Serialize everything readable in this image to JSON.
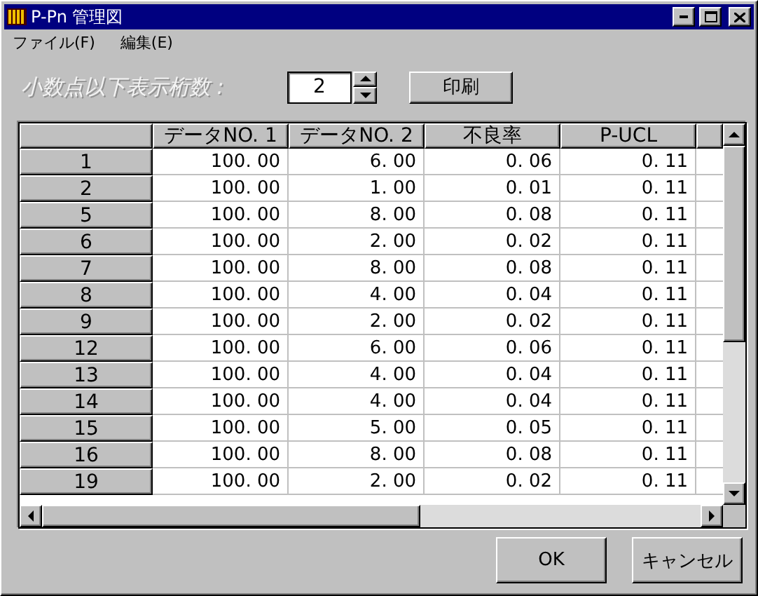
{
  "window": {
    "title": "P-Pn 管理図"
  },
  "menu": [
    {
      "label": "ファイル(F)"
    },
    {
      "label": "編集(E)"
    }
  ],
  "decimals": {
    "label": "小数点以下表示桁数 :",
    "value": "2"
  },
  "print_button": "印刷",
  "table": {
    "columns": [
      "データNO. 1",
      "データNO. 2",
      "不良率",
      "P-UCL"
    ],
    "rows": [
      {
        "header": "1",
        "cells": [
          "100. 00",
          "6. 00",
          "0. 06",
          "0. 11"
        ]
      },
      {
        "header": "2",
        "cells": [
          "100. 00",
          "1. 00",
          "0. 01",
          "0. 11"
        ]
      },
      {
        "header": "5",
        "cells": [
          "100. 00",
          "8. 00",
          "0. 08",
          "0. 11"
        ]
      },
      {
        "header": "6",
        "cells": [
          "100. 00",
          "2. 00",
          "0. 02",
          "0. 11"
        ]
      },
      {
        "header": "7",
        "cells": [
          "100. 00",
          "8. 00",
          "0. 08",
          "0. 11"
        ]
      },
      {
        "header": "8",
        "cells": [
          "100. 00",
          "4. 00",
          "0. 04",
          "0. 11"
        ]
      },
      {
        "header": "9",
        "cells": [
          "100. 00",
          "2. 00",
          "0. 02",
          "0. 11"
        ]
      },
      {
        "header": "12",
        "cells": [
          "100. 00",
          "6. 00",
          "0. 06",
          "0. 11"
        ]
      },
      {
        "header": "13",
        "cells": [
          "100. 00",
          "4. 00",
          "0. 04",
          "0. 11"
        ]
      },
      {
        "header": "14",
        "cells": [
          "100. 00",
          "4. 00",
          "0. 04",
          "0. 11"
        ]
      },
      {
        "header": "15",
        "cells": [
          "100. 00",
          "5. 00",
          "0. 05",
          "0. 11"
        ]
      },
      {
        "header": "16",
        "cells": [
          "100. 00",
          "8. 00",
          "0. 08",
          "0. 11"
        ]
      },
      {
        "header": "19",
        "cells": [
          "100. 00",
          "2. 00",
          "0. 02",
          "0. 11"
        ]
      }
    ]
  },
  "buttons": [
    "OK",
    "キャンセル"
  ]
}
